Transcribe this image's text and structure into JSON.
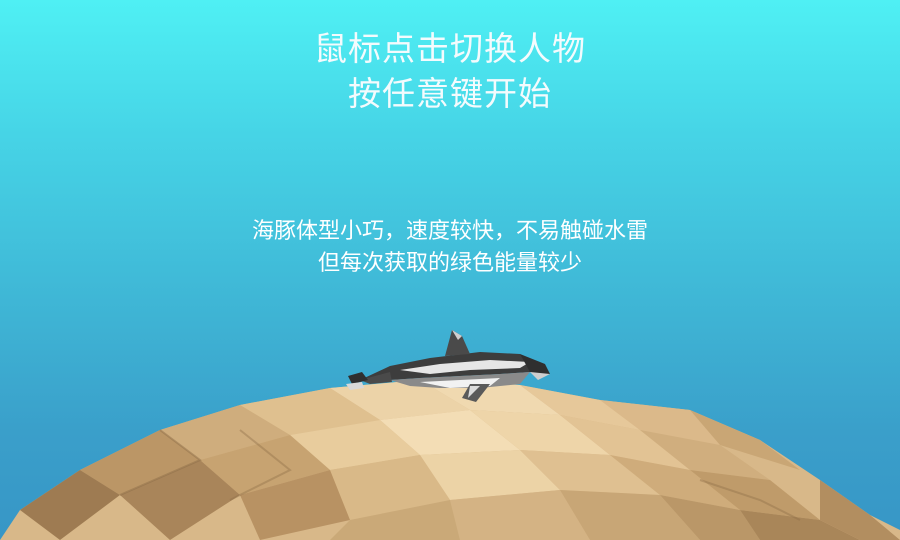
{
  "title": {
    "line1": "鼠标点击切换人物",
    "line2": "按任意键开始"
  },
  "character": {
    "name_icon": "dolphin-icon",
    "description_line1": "海豚体型小巧，速度较快，不易触碰水雷",
    "description_line2": "但每次获取的绿色能量较少"
  },
  "colors": {
    "sky_top": "#4ff0f4",
    "sky_bottom": "#3796c6",
    "sand_light": "#e9cc9c",
    "sand_mid": "#d4b283",
    "sand_dark": "#a8845a",
    "dolphin_dark": "#3a3a3a",
    "dolphin_light": "#e8e8e8"
  }
}
